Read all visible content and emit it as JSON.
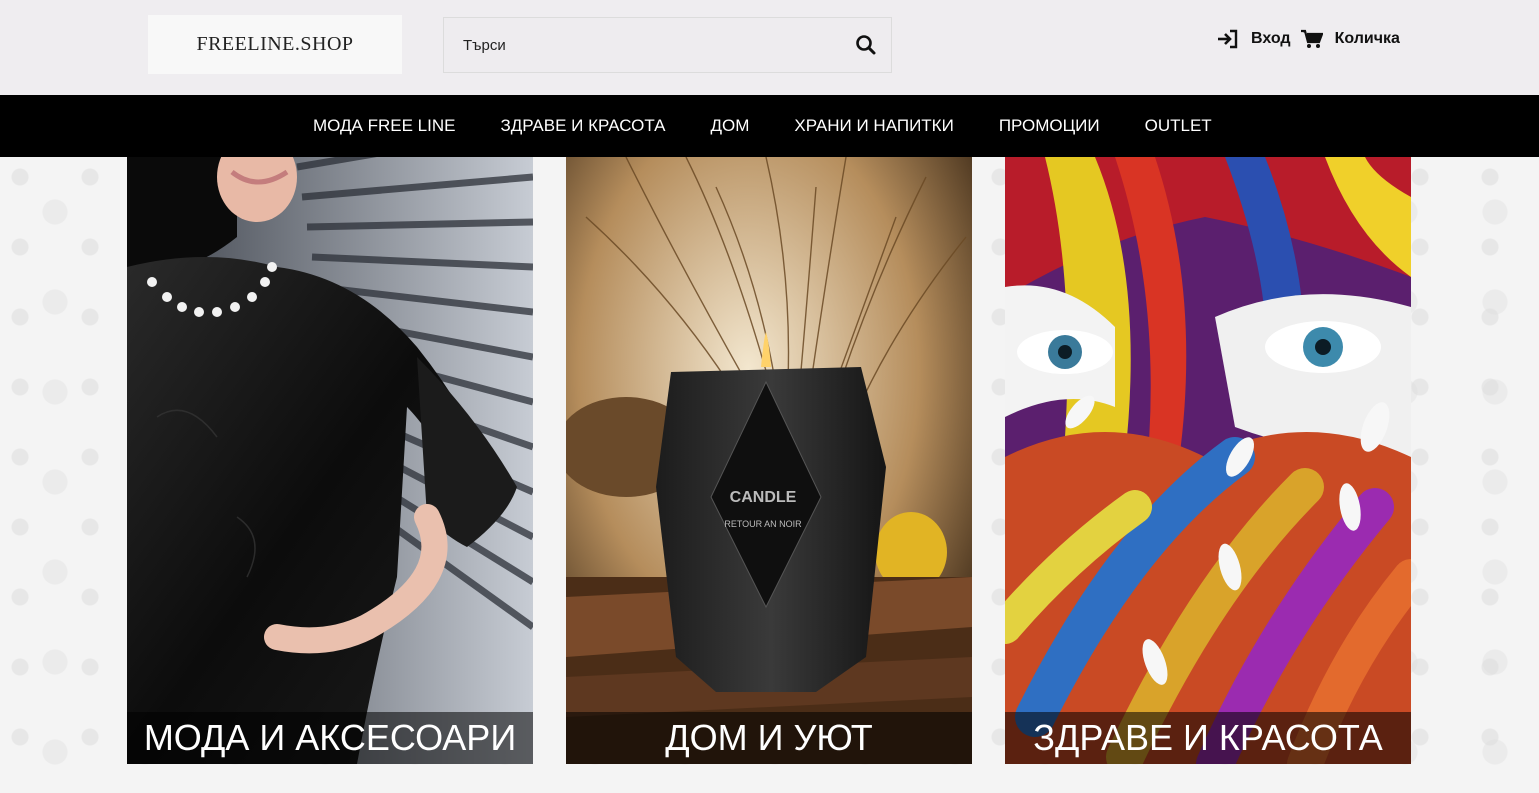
{
  "header": {
    "logo_text": "FREELINE.SHOP",
    "search": {
      "placeholder": "Търси",
      "value": ""
    },
    "login_label": "Вход",
    "cart_label": "Количка"
  },
  "nav": {
    "items": [
      {
        "label": "МОДА FREE LINE"
      },
      {
        "label": "ЗДРАВЕ И КРАСОТА"
      },
      {
        "label": "ДОМ"
      },
      {
        "label": "ХРАНИ И НАПИТКИ"
      },
      {
        "label": "ПРОМОЦИИ"
      },
      {
        "label": "OUTLET"
      }
    ]
  },
  "categories": [
    {
      "title": "МОДА И АКСЕСОАРИ",
      "image": "woman in black leather dress"
    },
    {
      "title": "ДОМ И УЮТ",
      "image": "black faceted candle with dried grass"
    },
    {
      "title": "ЗДРАВЕ И КРАСОТА",
      "image": "face with colorful paint"
    }
  ],
  "candle_label": {
    "brand": "CANDLE",
    "sub": "RETOUR AN NOIR"
  },
  "colors": {
    "header_bg": "#efedf0",
    "nav_bg": "#000000",
    "nav_text": "#ffffff"
  }
}
